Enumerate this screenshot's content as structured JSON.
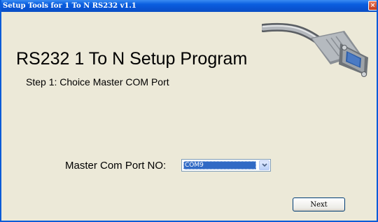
{
  "window": {
    "title": "Setup Tools for 1 To N  RS232 v1.1",
    "close_glyph": "×"
  },
  "header": {
    "app_title": "RS232 1 To N Setup Program",
    "step": "Step 1: Choice Master COM Port"
  },
  "form": {
    "port_label": "Master Com Port NO:",
    "port_value": "COM9"
  },
  "buttons": {
    "next": "Next"
  },
  "colors": {
    "titlebar": "#0A5FE0",
    "dialog_bg": "#ECE9D8",
    "selection": "#316AC5"
  },
  "icons": [
    "rs232-cable-icon",
    "close-icon",
    "chevron-down-icon"
  ]
}
